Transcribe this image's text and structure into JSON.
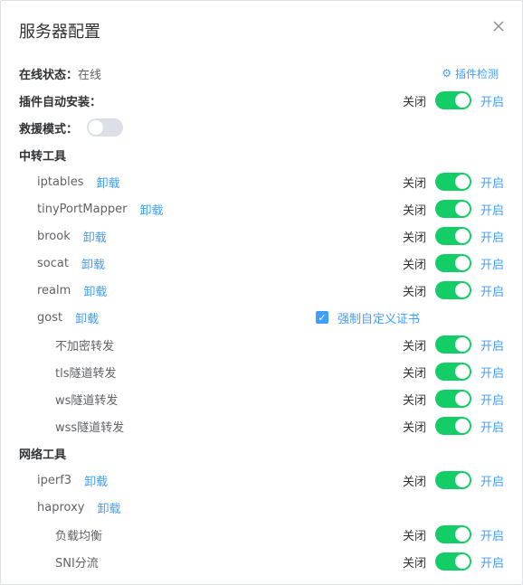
{
  "dialog": {
    "title": "服务器配置",
    "close_glyph": "×"
  },
  "status": {
    "label": "在线状态：",
    "value": "在线"
  },
  "plugin_check": {
    "icon": "gear-icon",
    "label": "插件检测"
  },
  "auto_install": {
    "label": "插件自动安装：",
    "off": "关闭",
    "on": "开启",
    "enabled": true
  },
  "rescue": {
    "label": "救援模式：",
    "enabled": false
  },
  "relay": {
    "title": "中转工具",
    "tools": [
      {
        "name": "iptables",
        "action": "卸载",
        "off": "关闭",
        "on": "开启",
        "enabled": true
      },
      {
        "name": "tinyPortMapper",
        "action": "卸载",
        "off": "关闭",
        "on": "开启",
        "enabled": true
      },
      {
        "name": "brook",
        "action": "卸载",
        "off": "关闭",
        "on": "开启",
        "enabled": true
      },
      {
        "name": "socat",
        "action": "卸载",
        "off": "关闭",
        "on": "开启",
        "enabled": true
      },
      {
        "name": "realm",
        "action": "卸载",
        "off": "关闭",
        "on": "开启",
        "enabled": true
      },
      {
        "name": "gost",
        "action": "卸载",
        "force_cert": {
          "label": "强制自定义证书",
          "checked": true
        }
      }
    ],
    "gost_modes": [
      {
        "name": "不加密转发",
        "off": "关闭",
        "on": "开启",
        "enabled": true
      },
      {
        "name": "tls隧道转发",
        "off": "关闭",
        "on": "开启",
        "enabled": true
      },
      {
        "name": "ws隧道转发",
        "off": "关闭",
        "on": "开启",
        "enabled": true
      },
      {
        "name": "wss隧道转发",
        "off": "关闭",
        "on": "开启",
        "enabled": true
      }
    ]
  },
  "network": {
    "title": "网络工具",
    "tools": [
      {
        "name": "iperf3",
        "action": "卸载",
        "off": "关闭",
        "on": "开启",
        "enabled": true
      },
      {
        "name": "haproxy",
        "action": "卸载"
      }
    ],
    "haproxy_modes": [
      {
        "name": "负载均衡",
        "off": "关闭",
        "on": "开启",
        "enabled": true
      },
      {
        "name": "SNI分流",
        "off": "关闭",
        "on": "开启",
        "enabled": true
      }
    ]
  }
}
